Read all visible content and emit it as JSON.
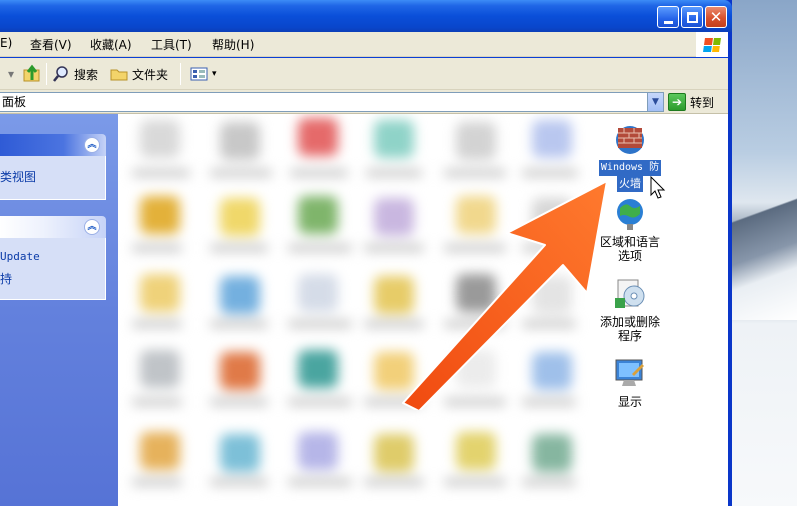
{
  "menubar": {
    "items": [
      {
        "label": "E)"
      },
      {
        "label": "查看(V)"
      },
      {
        "label": "收藏(A)"
      },
      {
        "label": "工具(T)"
      },
      {
        "label": "帮助(H)"
      }
    ]
  },
  "toolbar": {
    "search_label": "搜索",
    "folders_label": "文件夹"
  },
  "address": {
    "value": "面板",
    "go_label": "转到"
  },
  "leftpane": {
    "panel1_link": "类视图",
    "panel2_link1": "Update",
    "panel2_link2": "持"
  },
  "items": {
    "firewall_label_line1": "Windows 防",
    "firewall_label_line2": "火墙",
    "region_label": "区域和语言选项",
    "addremove_label": "添加或删除程序",
    "display_label": "显示"
  },
  "colors": {
    "titlebar": "#0a4fd9",
    "selection": "#316ac5",
    "taskpane": "#6381dd",
    "arrow": "#f2611a"
  },
  "icons": [
    "minimize-icon",
    "maximize-icon",
    "close-icon",
    "windows-flag-icon",
    "up-folder-icon",
    "search-icon",
    "folder-icon",
    "view-grid-icon",
    "dropdown-arrow-icon",
    "go-arrow-icon",
    "collapse-chevron-icon",
    "firewall-icon",
    "globe-icon",
    "add-remove-programs-icon",
    "display-icon",
    "mouse-cursor-icon",
    "annotation-arrow-icon"
  ]
}
